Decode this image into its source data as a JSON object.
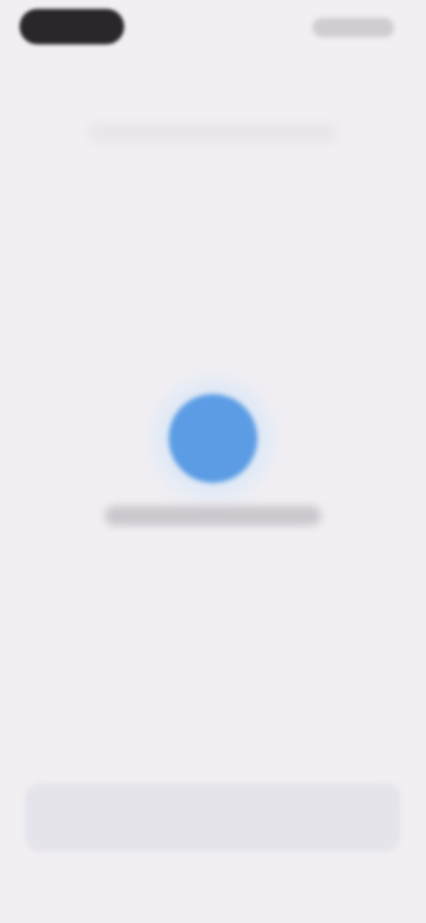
{
  "status_bar": {
    "time": "",
    "icons": [
      "signal-icon",
      "wifi-icon",
      "battery-icon"
    ]
  },
  "loader": {
    "label": "",
    "color": "#5b9ce4"
  },
  "colors": {
    "background": "#f2eff3",
    "accent": "#5b9ce4",
    "bottom_bar": "#e5e4eb"
  }
}
